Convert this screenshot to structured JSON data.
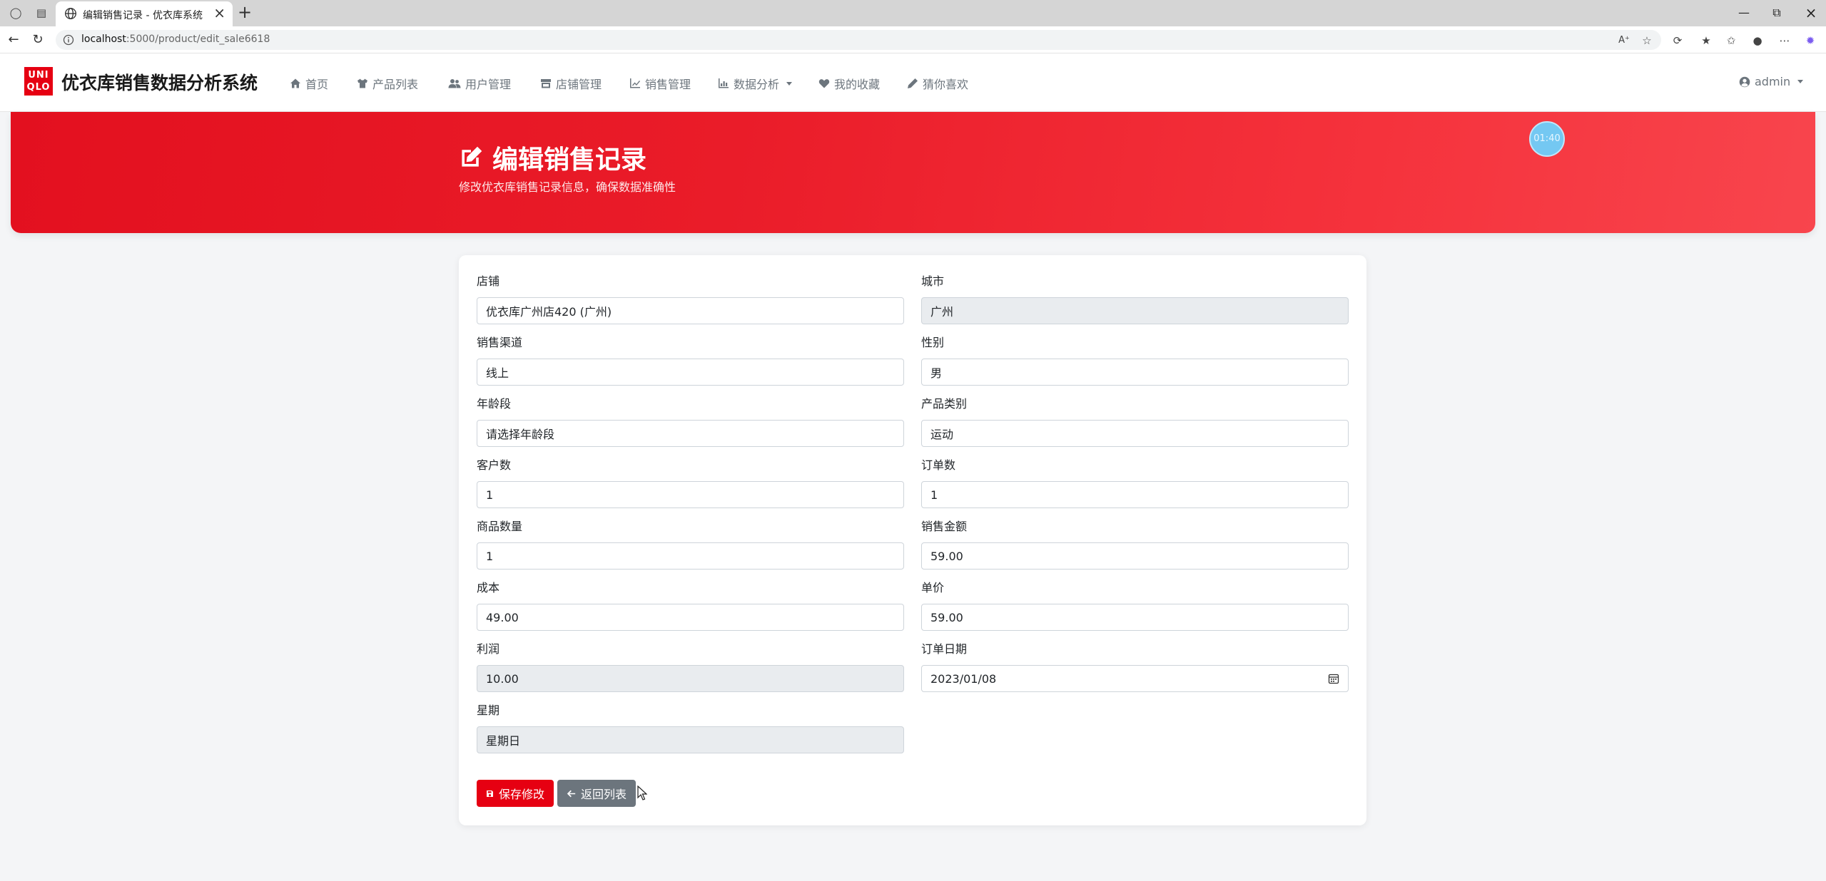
{
  "browser": {
    "tab_title": "编辑销售记录 - 优衣库系统",
    "url_host": "localhost",
    "url_path": ":5000/product/edit_sale6618"
  },
  "app": {
    "logo_line1": "UNI",
    "logo_line2": "QLO",
    "brand": "优衣库销售数据分析系统",
    "nav": [
      {
        "label": "首页",
        "icon": "home-icon"
      },
      {
        "label": "产品列表",
        "icon": "shirt-icon"
      },
      {
        "label": "用户管理",
        "icon": "users-icon"
      },
      {
        "label": "店铺管理",
        "icon": "store-icon"
      },
      {
        "label": "销售管理",
        "icon": "chart-line-icon"
      },
      {
        "label": "数据分析",
        "icon": "chart-bar-icon"
      },
      {
        "label": "我的收藏",
        "icon": "heart-icon"
      },
      {
        "label": "猜你喜欢",
        "icon": "pencil-icon"
      }
    ],
    "user": "admin"
  },
  "hero": {
    "title": "编辑销售记录",
    "subtitle": "修改优衣库销售记录信息，确保数据准确性",
    "timer": "01:40"
  },
  "form": {
    "store": {
      "label": "店铺",
      "value": "优衣库广州店420 (广州)"
    },
    "city": {
      "label": "城市",
      "value": "广州"
    },
    "channel": {
      "label": "销售渠道",
      "value": "线上"
    },
    "gender": {
      "label": "性别",
      "value": "男"
    },
    "age_group": {
      "label": "年龄段",
      "value": "请选择年龄段"
    },
    "category": {
      "label": "产品类别",
      "value": "运动"
    },
    "customers": {
      "label": "客户数",
      "value": "1"
    },
    "orders": {
      "label": "订单数",
      "value": "1"
    },
    "quantity": {
      "label": "商品数量",
      "value": "1"
    },
    "amount": {
      "label": "销售金额",
      "value": "59.00"
    },
    "cost": {
      "label": "成本",
      "value": "49.00"
    },
    "unit_price": {
      "label": "单价",
      "value": "59.00"
    },
    "profit": {
      "label": "利润",
      "value": "10.00"
    },
    "order_date": {
      "label": "订单日期",
      "value": "2023/01/08"
    },
    "weekday": {
      "label": "星期",
      "value": "星期日"
    }
  },
  "buttons": {
    "save": "保存修改",
    "back": "返回列表"
  },
  "colors": {
    "brand_red": "#e60012",
    "secondary": "#6c757d",
    "timer_blue": "#74c8f2"
  }
}
